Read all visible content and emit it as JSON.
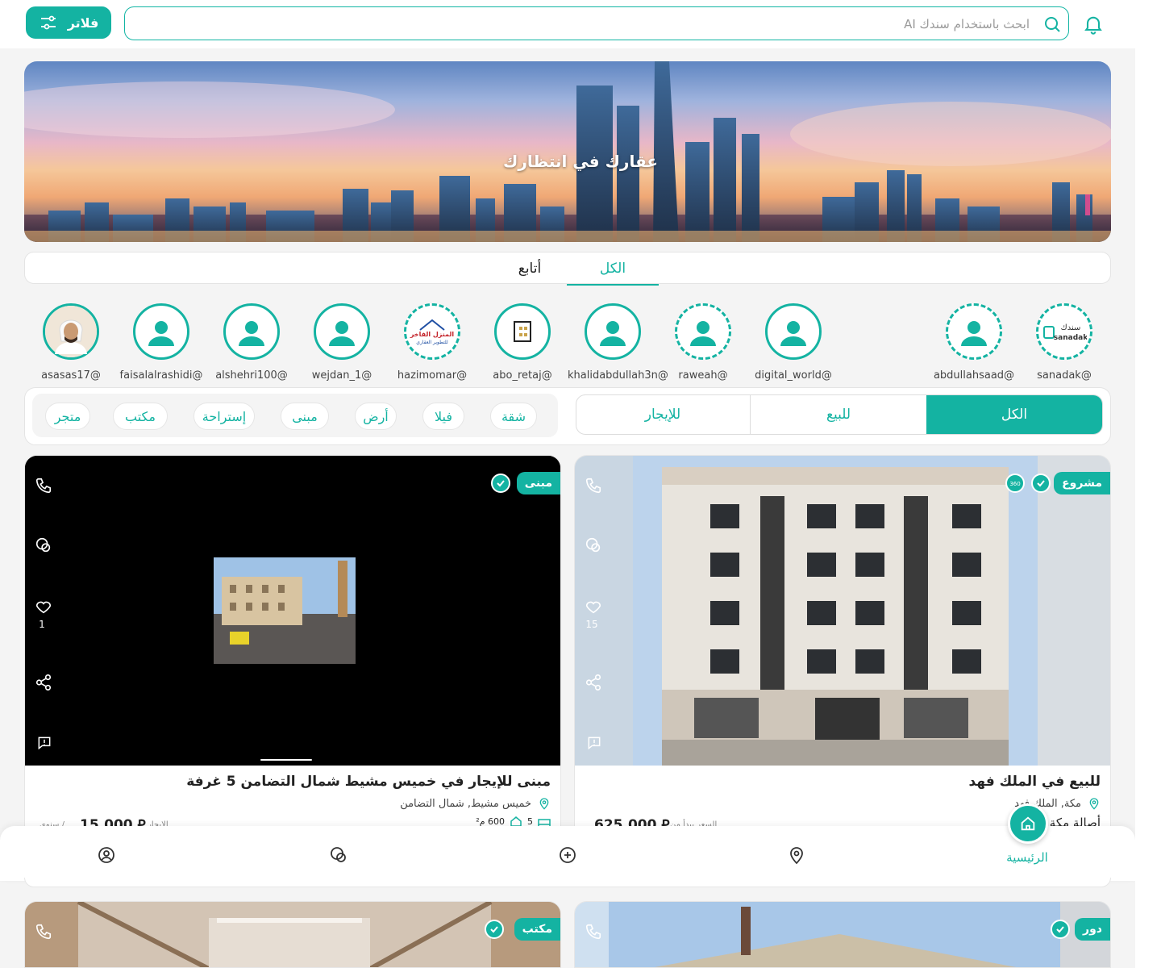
{
  "search": {
    "placeholder": "ابحث باستخدام سندك AI"
  },
  "header": {
    "filters_label": "فلاتر"
  },
  "banner": {
    "title": "عقارك في انتظارك"
  },
  "tabs": [
    {
      "label": "الكل",
      "active": true
    },
    {
      "label": "أتابع",
      "active": false
    }
  ],
  "accounts": [
    {
      "handle": "sanadak@",
      "logo_text": "سندك sanadak"
    },
    {
      "handle": "abdullahsaad@"
    },
    {
      "handle": "digital_world@"
    },
    {
      "handle": "raweah@"
    },
    {
      "handle": "khalidabdullah3n@"
    },
    {
      "handle": "abo_retaj@"
    },
    {
      "handle": "hazimomar@",
      "logo_text": "المنزل الفاخر للتطوير العقاري"
    },
    {
      "handle": "wejdan_1@"
    },
    {
      "handle": "alshehri100@"
    },
    {
      "handle": "faisalalrashidi@"
    },
    {
      "handle": "asasas17@"
    }
  ],
  "listing_filter": {
    "all": "الكل",
    "sale": "للبيع",
    "rent": "للإيجار"
  },
  "property_types": [
    "شقة",
    "فيلا",
    "أرض",
    "مبنى",
    "إستراحة",
    "مكتب",
    "متجر"
  ],
  "listings": [
    {
      "badge": "مشروع",
      "likes": "15",
      "title": "للبيع في الملك فهد",
      "location": "مكة, الملك فهد",
      "price": "625,000",
      "price_prefix": "السعر يبدأ من",
      "extra": "أصالة مكة",
      "has_360": true
    },
    {
      "badge": "مبنى",
      "likes": "1",
      "title": "مبنى للإيجار في خميس مشيط شمال التضامن 5 غرفة",
      "location": "خميس مشيط, شمال التضامن",
      "price": "15,000",
      "price_prefix": "الإيجار",
      "period": "/ سنوي",
      "rooms": "5",
      "area": "600 م²"
    },
    {
      "badge": "دور"
    },
    {
      "badge": "مكتب"
    }
  ],
  "bottom_nav": {
    "home": "الرئيسية"
  },
  "colors": {
    "accent": "#14b3a2"
  }
}
